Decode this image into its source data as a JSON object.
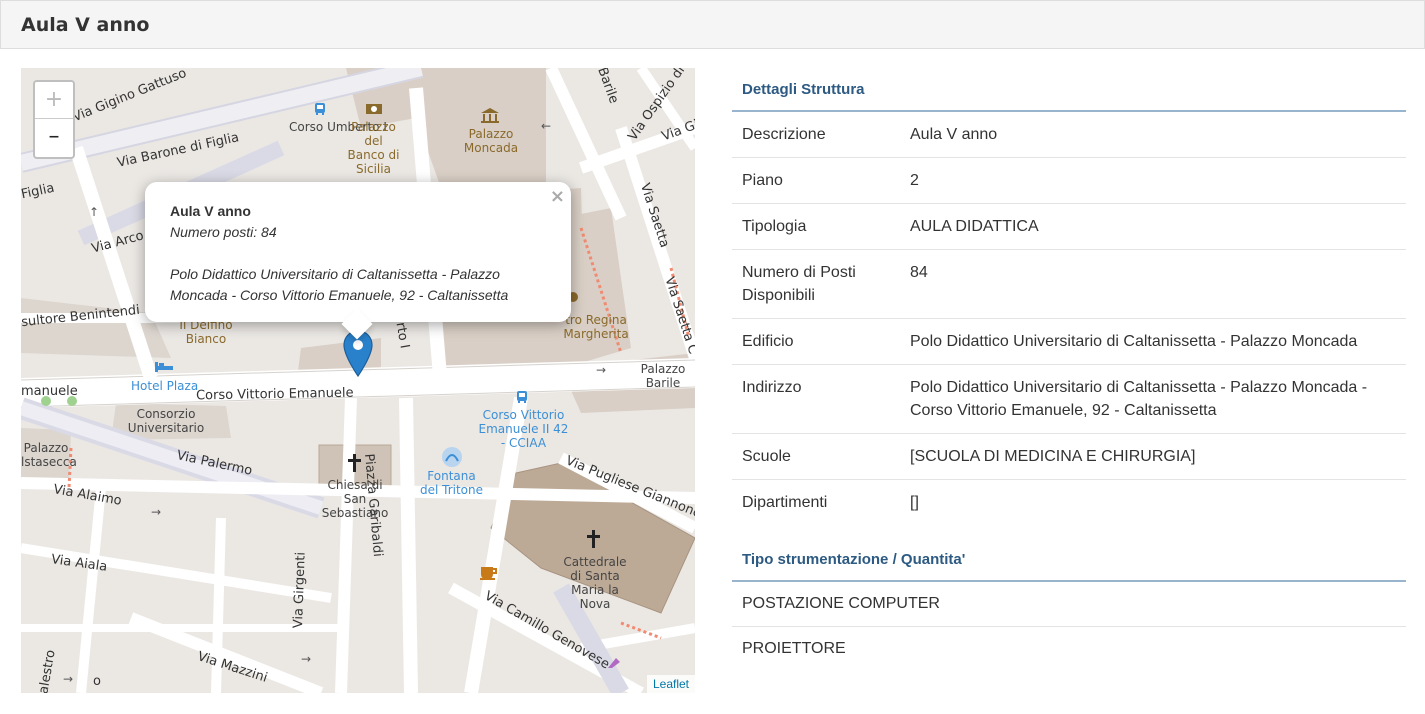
{
  "page": {
    "title": "Aula V anno"
  },
  "map": {
    "zoom_in": "+",
    "zoom_out": "–",
    "attribution": "Leaflet",
    "labels": {
      "via_gigino_gattuso": "Via Gigino Gattuso",
      "via_barone_di_figlia": "Via Barone di Figlia",
      "figlia": "Figlia",
      "via_arco": "Via Arco",
      "sultore_benintendi": "sultore Benintendi",
      "corso_umberto": "Corso Umberto I",
      "palazzo_banco_sicilia": "Palazzo del Banco di Sicilia",
      "palazzo_short": "Palazzo",
      "palazzo_moncada": "Palazzo Moncada",
      "barile": "Barile",
      "via_ospizio": "Via Ospizio di",
      "via_gia": "Via Gia",
      "via_saetta": "Via Saetta",
      "via_saetta_c": "Via Saetta C",
      "il_delfino_bianco": "Il Delfino Bianco",
      "teatro_regina_margherita": "tro Regina Margherita",
      "hotel_plaza": "Hotel Plaza",
      "manuele": "manuele",
      "corso_vittorio_emanuele": "Corso Vittorio Emanuele",
      "palazzo_barile": "Palazzo Barile",
      "consorzio_universitario": "Consorzio Universitario",
      "corso_vittorio_emanuele_stop": "Corso Vittorio Emanuele II 42 - CCIAA",
      "palazzo_lstasecca": "Palazzo lstasecca",
      "via_palermo": "Via Palermo",
      "piazza_garibaldi": "Piazza Garibaldi",
      "fontana_del_tritone": "Fontana del Tritone",
      "chiesa_san_sebastiano": "Chiesa di San Sebastiano",
      "via_pugliese_giannone": "Via Pugliese Giannone",
      "via_alaimo": "Via Alaimo",
      "via_aiala": "Via Aiala",
      "cattedrale": "Cattedrale di Santa Maria la Nova",
      "via_camillo_genovese": "Via Camillo Genovese",
      "via_girgenti": "Via Girgenti",
      "via_mazzini": "Via Mazzini",
      "palestro": "Palestro",
      "o": "o",
      "rto_i": "rto I"
    },
    "popup": {
      "title": "Aula V anno",
      "seats": "Numero posti: 84",
      "address_line1": "Polo Didattico Universitario di Caltanissetta - Palazzo",
      "address_line2": "Moncada - Corso Vittorio Emanuele, 92 - Caltanissetta",
      "close": "×"
    }
  },
  "details": {
    "title": "Dettagli Struttura",
    "rows": [
      {
        "label": "Descrizione",
        "value": "Aula V anno"
      },
      {
        "label": "Piano",
        "value": "2"
      },
      {
        "label": "Tipologia",
        "value": "AULA DIDATTICA"
      },
      {
        "label_line1": "Numero di Posti",
        "label_line2": "Disponibili",
        "value": "84"
      },
      {
        "label": "Edificio",
        "value": "Polo Didattico Universitario di Caltanissetta - Palazzo Moncada"
      },
      {
        "label": "Indirizzo",
        "value_line1": "Polo Didattico Universitario di Caltanissetta - Palazzo Moncada -",
        "value_line2": "Corso Vittorio Emanuele, 92 - Caltanissetta"
      },
      {
        "label": "Scuole",
        "value": "[SCUOLA DI MEDICINA E CHIRURGIA]"
      },
      {
        "label": "Dipartimenti",
        "value": "[]"
      }
    ]
  },
  "equipment": {
    "title": "Tipo strumentazione / Quantita'",
    "items": [
      "POSTAZIONE COMPUTER",
      "PROIETTORE"
    ]
  },
  "colors": {
    "section_title": "#2d5a82",
    "section_rule": "#98b5cd",
    "marker": "#2a81cb",
    "link": "#0078a8"
  }
}
